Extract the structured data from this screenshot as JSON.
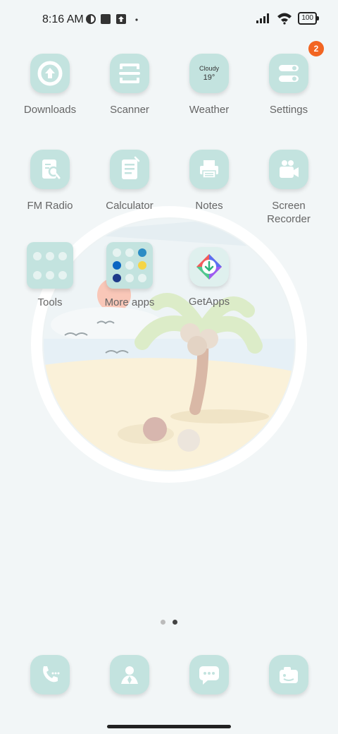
{
  "status_bar": {
    "time": "8:16 AM",
    "battery": "100",
    "icons": [
      "theme-icon",
      "square-app-icon",
      "upload-icon",
      "dot-icon",
      "signal-icon",
      "wifi-icon",
      "battery-icon"
    ]
  },
  "apps": [
    {
      "label": "Downloads",
      "icon": "download-icon"
    },
    {
      "label": "Scanner",
      "icon": "scanner-icon"
    },
    {
      "label": "Weather",
      "icon": "weather-icon",
      "weather_text": "Cloudy",
      "temperature": "19°"
    },
    {
      "label": "Settings",
      "icon": "settings-icon",
      "badge": "2"
    },
    {
      "label": "FM Radio",
      "icon": "radio-icon"
    },
    {
      "label": "Calculator",
      "icon": "calculator-icon"
    },
    {
      "label": "Notes",
      "icon": "notes-icon"
    },
    {
      "label": "Screen Recorder",
      "icon": "video-camera-icon"
    },
    {
      "label": "Tools",
      "icon": "folder-icon"
    },
    {
      "label": "More apps",
      "icon": "folder-icon"
    },
    {
      "label": "GetApps",
      "icon": "getapps-icon"
    }
  ],
  "pages": {
    "count": 2,
    "active": 2
  },
  "dock": [
    {
      "icon": "phone-icon"
    },
    {
      "icon": "contacts-icon"
    },
    {
      "icon": "messages-icon"
    },
    {
      "icon": "camera-icon"
    }
  ],
  "colors": {
    "icon_bg": "#c3e3df",
    "badge": "#f26522",
    "background": "#f2f6f7"
  }
}
